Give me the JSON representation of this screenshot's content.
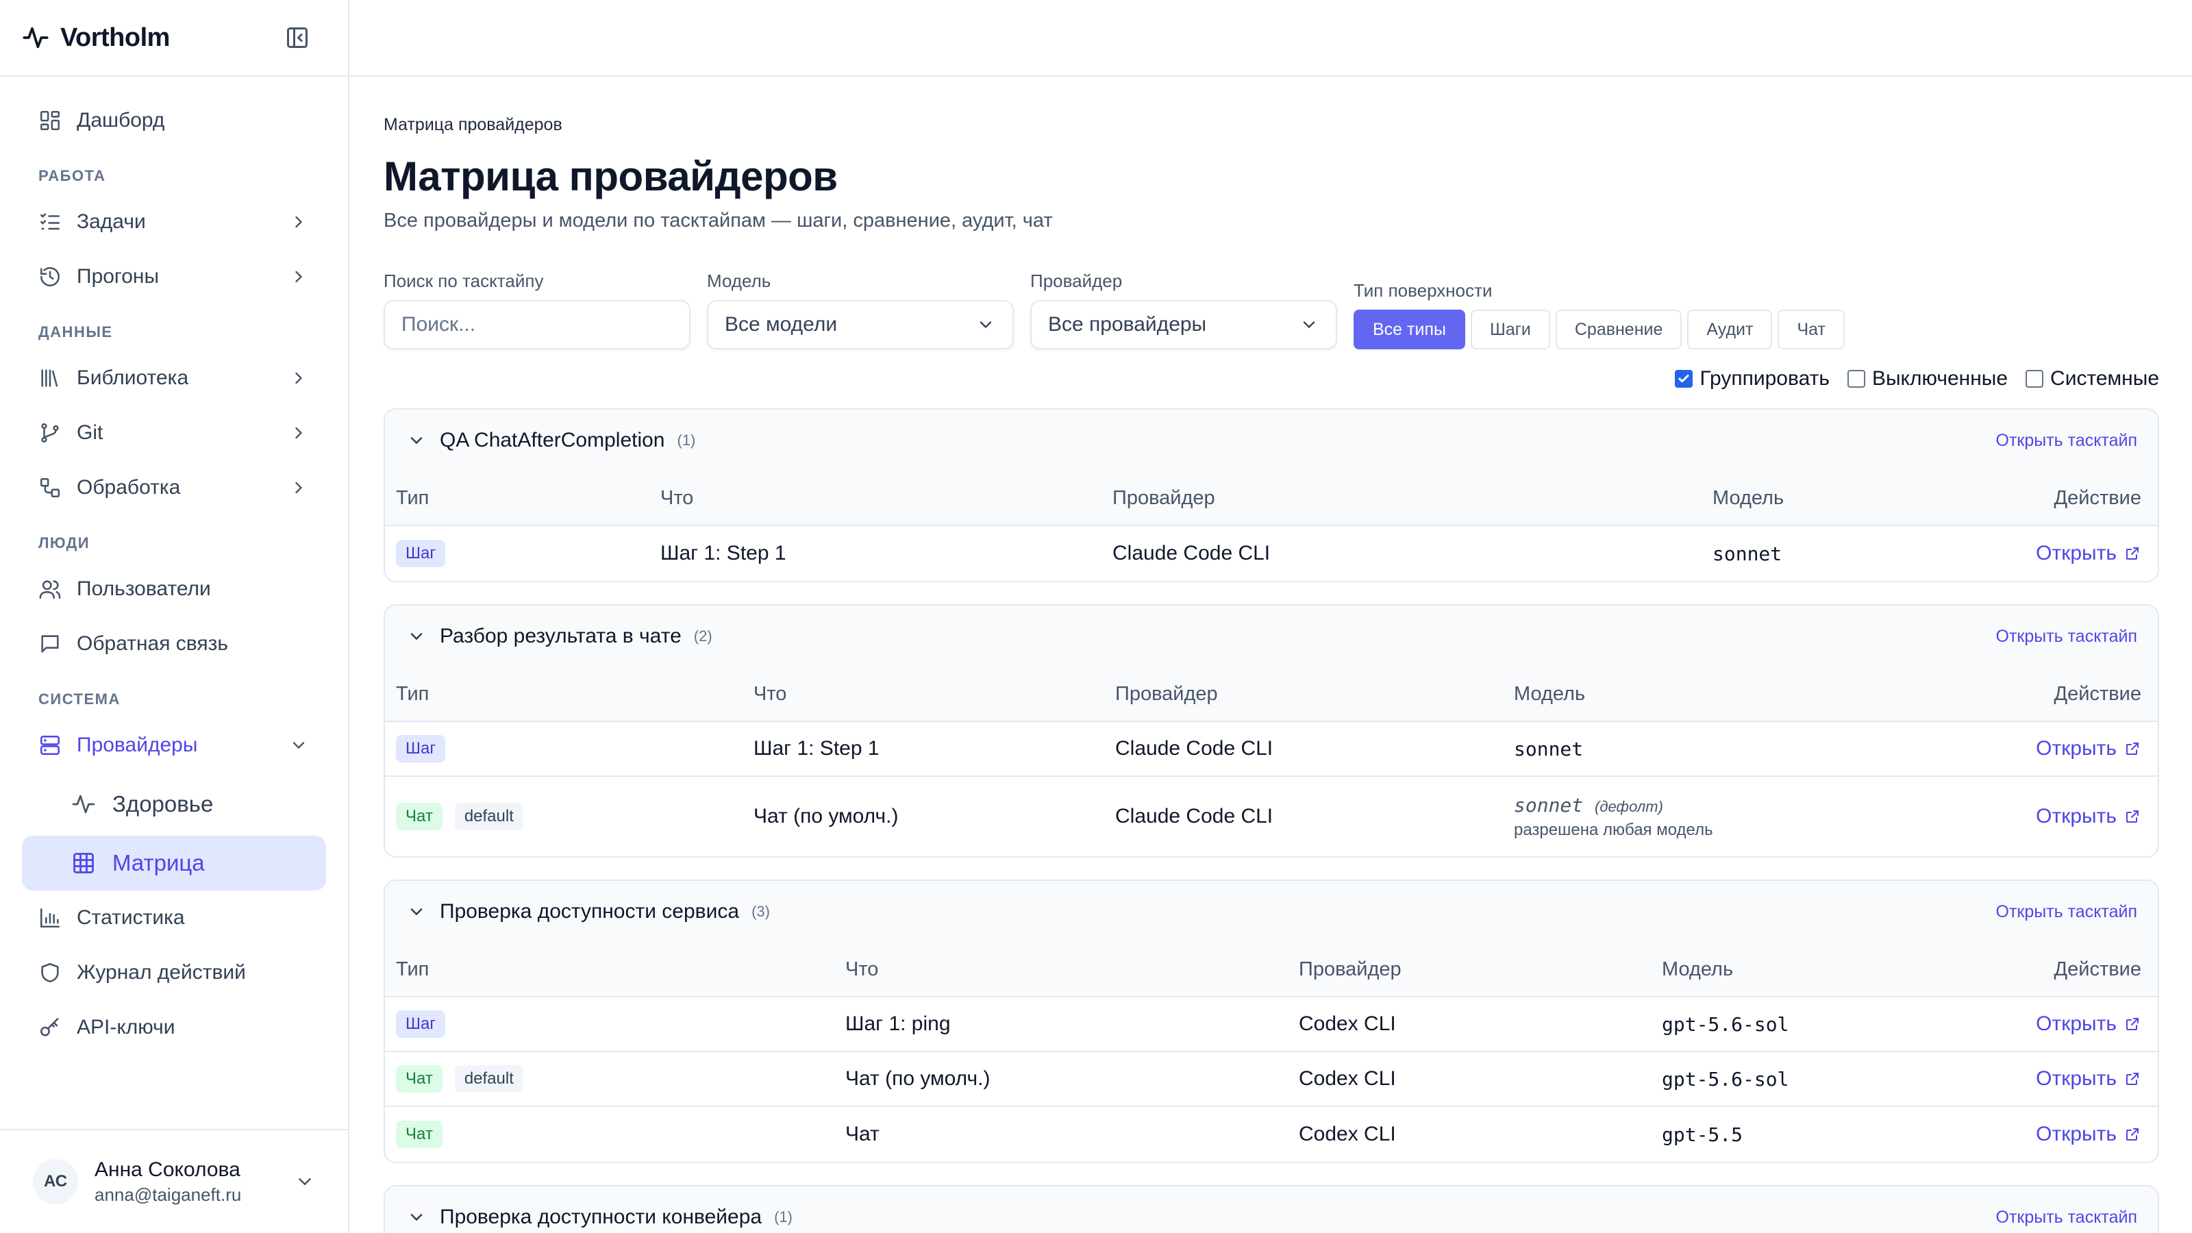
{
  "brand": {
    "name": "Vortholm"
  },
  "sidebar": {
    "dashboard": "Дашборд",
    "sections": {
      "work": "РАБОТА",
      "data": "ДАННЫЕ",
      "people": "ЛЮДИ",
      "system": "СИСТЕМА"
    },
    "items": {
      "tasks": "Задачи",
      "runs": "Прогоны",
      "library": "Библиотека",
      "git": "Git",
      "processing": "Обработка",
      "users": "Пользователи",
      "feedback": "Обратная связь",
      "providers": "Провайдеры",
      "health": "Здоровье",
      "matrix": "Матрица",
      "stats": "Статистика",
      "audit_log": "Журнал действий",
      "api_keys": "API-ключи"
    },
    "user": {
      "initials": "АС",
      "name": "Анна Соколова",
      "email": "anna@taiganeft.ru"
    }
  },
  "page": {
    "breadcrumb": "Матрица провайдеров",
    "title": "Матрица провайдеров",
    "subtitle": "Все провайдеры и модели по тасктайпам — шаги, сравнение, аудит, чат"
  },
  "filters": {
    "search": {
      "label": "Поиск по тасктайпу",
      "placeholder": "Поиск..."
    },
    "model": {
      "label": "Модель",
      "value": "Все модели"
    },
    "provider": {
      "label": "Провайдер",
      "value": "Все провайдеры"
    },
    "surface": {
      "label": "Тип поверхности",
      "options": [
        "Все типы",
        "Шаги",
        "Сравнение",
        "Аудит",
        "Чат"
      ],
      "active": "Все типы"
    },
    "checks": {
      "group": {
        "label": "Группировать",
        "checked": true
      },
      "disabled": {
        "label": "Выключенные",
        "checked": false
      },
      "system": {
        "label": "Системные",
        "checked": false
      }
    }
  },
  "table_headers": {
    "type": "Тип",
    "what": "Что",
    "provider": "Провайдер",
    "model": "Модель",
    "action": "Действие"
  },
  "open_tasktype_label": "Открыть тасктайп",
  "open_label": "Открыть",
  "groups": [
    {
      "title": "QA ChatAfterCompletion",
      "count": "(1)",
      "rows": [
        {
          "type": "Шаг",
          "what": "Шаг 1: Step 1",
          "provider": "Claude Code CLI",
          "model": "sonnet"
        }
      ]
    },
    {
      "title": "Разбор результата в чате",
      "count": "(2)",
      "rows": [
        {
          "type": "Шаг",
          "what": "Шаг 1: Step 1",
          "provider": "Claude Code CLI",
          "model": "sonnet"
        },
        {
          "type": "Чат",
          "tag": "default",
          "what": "Чат (по умолч.)",
          "provider": "Claude Code CLI",
          "model": "sonnet",
          "model_suffix": "(дефолт)",
          "model_note": "разрешена любая модель"
        }
      ]
    },
    {
      "title": "Проверка доступности сервиса",
      "count": "(3)",
      "rows": [
        {
          "type": "Шаг",
          "what": "Шаг 1: ping",
          "provider": "Codex CLI",
          "model": "gpt-5.6-sol"
        },
        {
          "type": "Чат",
          "tag": "default",
          "what": "Чат (по умолч.)",
          "provider": "Codex CLI",
          "model": "gpt-5.6-sol"
        },
        {
          "type": "Чат",
          "what": "Чат",
          "provider": "Codex CLI",
          "model": "gpt-5.5"
        }
      ]
    },
    {
      "title": "Проверка доступности конвейера",
      "count": "(1)",
      "rows": []
    }
  ]
}
